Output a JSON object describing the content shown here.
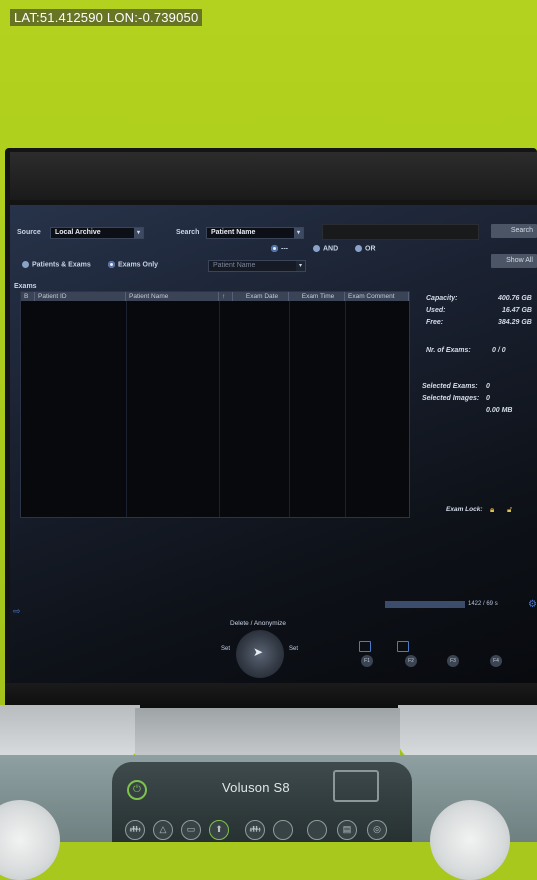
{
  "overlay": {
    "gps": "LAT:51.412590 LON:-0.739050"
  },
  "ui": {
    "source_label": "Source",
    "source_value": "Local Archive",
    "search_label": "Search",
    "search_value": "Patient Name",
    "search_button": "Search",
    "show_all_button": "Show All",
    "radio_none": "---",
    "radio_and": "AND",
    "radio_or": "OR",
    "second_field": "Patient Name",
    "mode_patients": "Patients & Exams",
    "mode_exams": "Exams Only",
    "exams_title": "Exams",
    "columns": [
      "B",
      "Patient ID",
      "Patient Name",
      "↑",
      "Exam Date",
      "Exam Time",
      "Exam Comment"
    ],
    "capacity_label": "Capacity:",
    "capacity_value": "400.76 GB",
    "used_label": "Used:",
    "used_value": "16.47 GB",
    "free_label": "Free:",
    "free_value": "384.29 GB",
    "nr_exams_label": "Nr. of Exams:",
    "nr_exams_value": "0 / 0",
    "selected_exams_label": "Selected Exams:",
    "selected_exams_value": "0",
    "selected_images_label": "Selected Images:",
    "selected_images_value": "0",
    "selected_size": "0.00 MB",
    "exam_lock_label": "Exam Lock:",
    "progress_text": "1422 / 69 s",
    "delete_label": "Delete / Anonymize",
    "set_left": "Set",
    "set_right": "Set",
    "fkeys": [
      "F1",
      "F2",
      "F3",
      "F4"
    ]
  },
  "device": {
    "brand": "Voluson S8"
  },
  "colors": {
    "wall": "#a9c91c",
    "screen": "#1a2131",
    "accent": "#4c7ac9",
    "power": "#7fc24c"
  }
}
